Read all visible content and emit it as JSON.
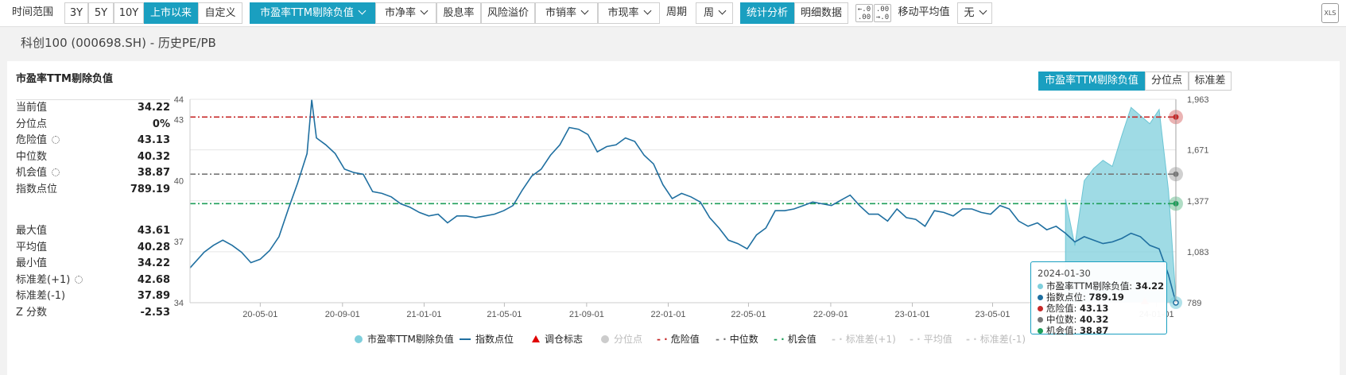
{
  "toolbar": {
    "time_range_label": "时间范围",
    "time_buttons": [
      "3Y",
      "5Y",
      "10Y",
      "上市以来",
      "自定义"
    ],
    "metric_dropdown": "市盈率TTM剔除负值",
    "metric_tabs": [
      "市净率",
      "股息率",
      "风险溢价",
      "市销率",
      "市现率"
    ],
    "period_label": "周期",
    "period_value": "周",
    "view_tabs": [
      "统计分析",
      "明细数据"
    ],
    "decimal_inc": "←.0\n.00",
    "decimal_dec": ".00\n→.0",
    "ma_label": "移动平均值",
    "ma_value": "无",
    "export_label": "XLS"
  },
  "subtitle": "科创100 (000698.SH) - 历史PE/PB",
  "panel": {
    "title": "市盈率TTM剔除负值",
    "seg_tabs": [
      "市盈率TTM剔除负值",
      "分位点",
      "标准差"
    ],
    "stats_top": [
      {
        "label": "当前值",
        "value": "34.22",
        "gear": false
      },
      {
        "label": "分位点",
        "value": "0%",
        "gear": false
      },
      {
        "label": "危险值",
        "value": "43.13",
        "gear": true
      },
      {
        "label": "中位数",
        "value": "40.32",
        "gear": false
      },
      {
        "label": "机会值",
        "value": "38.87",
        "gear": true
      },
      {
        "label": "指数点位",
        "value": "789.19",
        "gear": false
      }
    ],
    "stats_bottom": [
      {
        "label": "最大值",
        "value": "43.61",
        "gear": false
      },
      {
        "label": "平均值",
        "value": "40.28",
        "gear": false
      },
      {
        "label": "最小值",
        "value": "34.22",
        "gear": false
      },
      {
        "label": "标准差(+1)",
        "value": "42.68",
        "gear": true
      },
      {
        "label": "标准差(-1)",
        "value": "37.89",
        "gear": false
      },
      {
        "label": "Z 分数",
        "value": "-2.53",
        "gear": false
      }
    ]
  },
  "tooltip": {
    "date": "2024-01-30",
    "rows": [
      {
        "label": "市盈率TTM剔除负值:",
        "value": "34.22",
        "color": "#7fcfdc"
      },
      {
        "label": "指数点位:",
        "value": "789.19",
        "color": "#1f6fa0"
      },
      {
        "label": "危险值:",
        "value": "43.13",
        "color": "#c62828"
      },
      {
        "label": "中位数:",
        "value": "40.32",
        "color": "#777777"
      },
      {
        "label": "机会值:",
        "value": "38.87",
        "color": "#1e9e5a"
      }
    ]
  },
  "legend": [
    {
      "label": "市盈率TTM剔除负值",
      "kind": "dot",
      "color": "#7fcfdc",
      "off": false
    },
    {
      "label": "指数点位",
      "kind": "line",
      "color": "#1f6fa0",
      "off": false
    },
    {
      "label": "调仓标志",
      "kind": "tri",
      "color": "#e00000",
      "off": false
    },
    {
      "label": "分位点",
      "kind": "dot",
      "color": "#cccccc",
      "off": true
    },
    {
      "label": "危险值",
      "kind": "dash",
      "color": "#c62828",
      "off": false
    },
    {
      "label": "中位数",
      "kind": "dash",
      "color": "#777777",
      "off": false
    },
    {
      "label": "机会值",
      "kind": "dash",
      "color": "#1e9e5a",
      "off": false
    },
    {
      "label": "标准差(+1)",
      "kind": "dash",
      "color": "#cccccc",
      "off": true
    },
    {
      "label": "平均值",
      "kind": "dash",
      "color": "#cccccc",
      "off": true
    },
    {
      "label": "标准差(-1)",
      "kind": "dash",
      "color": "#cccccc",
      "off": true
    }
  ],
  "colors": {
    "accent": "#1a9fc0",
    "pe_area": "#7fcfdc",
    "index_line": "#1f6fa0",
    "danger": "#c62828",
    "median": "#777777",
    "opportunity": "#1e9e5a"
  },
  "chart_data": {
    "type": "line",
    "left_axis": {
      "ticks": [
        34,
        37,
        40,
        43,
        44
      ],
      "range": [
        34,
        44
      ]
    },
    "right_axis": {
      "ticks": [
        "789",
        "1,083",
        "1,377",
        "1,671",
        "1,963"
      ],
      "range": [
        789,
        1963
      ]
    },
    "x_ticks": [
      "20-05-01",
      "20-09-01",
      "21-01-01",
      "21-05-01",
      "21-09-01",
      "22-01-01",
      "22-05-01",
      "22-09-01",
      "23-01-01",
      "23-05-01",
      "24-01-01"
    ],
    "reference_lines": {
      "danger": 43.13,
      "median": 40.32,
      "opportunity": 38.87
    },
    "series": [
      {
        "name": "指数点位",
        "axis": "right",
        "x": [
          "2020-01-17",
          "2020-02-07",
          "2020-02-21",
          "2020-03-06",
          "2020-03-20",
          "2020-04-03",
          "2020-04-17",
          "2020-05-01",
          "2020-05-15",
          "2020-05-29",
          "2020-06-12",
          "2020-06-26",
          "2020-07-10",
          "2020-07-17",
          "2020-07-24",
          "2020-08-07",
          "2020-08-21",
          "2020-09-04",
          "2020-09-18",
          "2020-10-02",
          "2020-10-16",
          "2020-10-30",
          "2020-11-13",
          "2020-11-27",
          "2020-12-11",
          "2020-12-25",
          "2021-01-08",
          "2021-01-22",
          "2021-02-05",
          "2021-02-19",
          "2021-03-05",
          "2021-03-19",
          "2021-04-02",
          "2021-04-16",
          "2021-04-30",
          "2021-05-14",
          "2021-05-28",
          "2021-06-11",
          "2021-06-25",
          "2021-07-09",
          "2021-07-23",
          "2021-08-06",
          "2021-08-20",
          "2021-09-03",
          "2021-09-17",
          "2021-10-01",
          "2021-10-15",
          "2021-10-29",
          "2021-11-12",
          "2021-11-26",
          "2021-12-10",
          "2021-12-24",
          "2022-01-07",
          "2022-01-21",
          "2022-02-04",
          "2022-02-18",
          "2022-03-04",
          "2022-03-18",
          "2022-04-01",
          "2022-04-15",
          "2022-04-29",
          "2022-05-13",
          "2022-05-27",
          "2022-06-10",
          "2022-06-24",
          "2022-07-08",
          "2022-07-22",
          "2022-08-05",
          "2022-08-19",
          "2022-09-02",
          "2022-09-16",
          "2022-09-30",
          "2022-10-14",
          "2022-10-28",
          "2022-11-11",
          "2022-11-25",
          "2022-12-09",
          "2022-12-23",
          "2023-01-06",
          "2023-01-20",
          "2023-02-03",
          "2023-02-17",
          "2023-03-03",
          "2023-03-17",
          "2023-03-31",
          "2023-04-14",
          "2023-04-28",
          "2023-05-12",
          "2023-05-26",
          "2023-06-09",
          "2023-06-23",
          "2023-07-07",
          "2023-07-21",
          "2023-08-04",
          "2023-08-18",
          "2023-09-01",
          "2023-09-15",
          "2023-09-29",
          "2023-10-13",
          "2023-10-27",
          "2023-11-10",
          "2023-11-24",
          "2023-12-08",
          "2023-12-22",
          "2024-01-05",
          "2024-01-19",
          "2024-01-30"
        ],
        "values": [
          990,
          1080,
          1120,
          1150,
          1120,
          1080,
          1020,
          1040,
          1090,
          1170,
          1330,
          1480,
          1650,
          1960,
          1740,
          1700,
          1650,
          1560,
          1540,
          1530,
          1430,
          1420,
          1400,
          1360,
          1340,
          1310,
          1290,
          1300,
          1250,
          1290,
          1290,
          1280,
          1290,
          1300,
          1320,
          1350,
          1440,
          1520,
          1560,
          1640,
          1700,
          1800,
          1790,
          1760,
          1660,
          1690,
          1700,
          1740,
          1720,
          1640,
          1590,
          1470,
          1390,
          1420,
          1400,
          1370,
          1280,
          1220,
          1150,
          1130,
          1100,
          1180,
          1220,
          1320,
          1320,
          1330,
          1350,
          1370,
          1360,
          1350,
          1380,
          1410,
          1350,
          1300,
          1300,
          1260,
          1330,
          1280,
          1270,
          1230,
          1320,
          1310,
          1290,
          1330,
          1330,
          1310,
          1300,
          1350,
          1330,
          1260,
          1230,
          1250,
          1210,
          1230,
          1190,
          1140,
          1170,
          1150,
          1130,
          1140,
          1160,
          1190,
          1170,
          1120,
          1100,
          950,
          789.19
        ]
      },
      {
        "name": "市盈率TTM剔除负值",
        "axis": "left",
        "x": [
          "2023-08-18",
          "2023-09-01",
          "2023-09-15",
          "2023-09-29",
          "2023-10-13",
          "2023-10-27",
          "2023-11-10",
          "2023-11-24",
          "2023-12-08",
          "2023-12-22",
          "2024-01-05",
          "2024-01-19",
          "2024-01-30"
        ],
        "values": [
          39.1,
          36.8,
          40,
          40.6,
          41,
          40.7,
          42.2,
          43.6,
          43.2,
          42.8,
          43.5,
          39.5,
          34.22
        ]
      }
    ]
  }
}
